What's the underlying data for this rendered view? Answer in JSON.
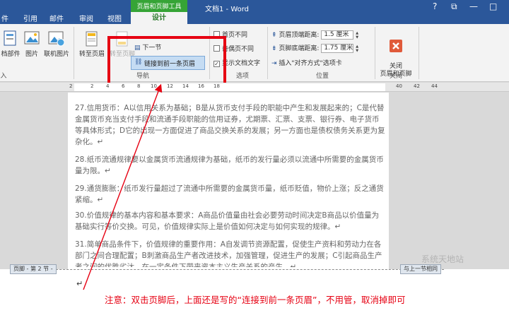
{
  "titlebar": {
    "tabs": [
      "件",
      "引用",
      "邮件",
      "审阅",
      "视图"
    ],
    "contextual_title": "页眉和页脚工具",
    "contextual_tab": "设计",
    "doc_title": "文档1 - Word",
    "controls": [
      "?",
      "⧉",
      "—",
      "□"
    ]
  },
  "ribbon": {
    "insert_group": {
      "buttons": [
        "档部件",
        "图片",
        "联机图片"
      ],
      "label": "入"
    },
    "navigation": {
      "goto_header": "转至页眉",
      "goto_footer": "转至页脚",
      "next_section": "下一节",
      "link_previous": "链接到前一条页眉",
      "label": "导航"
    },
    "options": {
      "items": [
        {
          "label": "首页不同",
          "checked": false
        },
        {
          "label": "奇偶页不同",
          "checked": false
        },
        {
          "label": "显示文档文字",
          "checked": true
        }
      ],
      "label": "选项"
    },
    "position": {
      "header_label": "页眉顶端距离:",
      "header_value": "1.5 厘米",
      "footer_label": "页脚底端距离:",
      "footer_value": "1.75 厘米",
      "align_tab": "插入\"对齐方式\"选项卡",
      "label": "位置"
    },
    "close": {
      "button": "关闭\n页眉和页脚",
      "label": "关闭"
    }
  },
  "ruler": {
    "numbers": [
      "2",
      "2",
      "4",
      "6",
      "8",
      "10",
      "12",
      "14",
      "16",
      "18"
    ],
    "side_numbers": [
      "40",
      "42",
      "44"
    ]
  },
  "document": {
    "paragraphs": [
      "27.信用货币：A以信用关系为基础；B是从货币支付手段的职能中产生和发展起来的；C是代替金属货币充当支付手段和流通手段职能的信用证券，尤期票、汇票、支票、银行券、电子货币等具体形式；D它的出现一方面促进了商品交换关系的发展；另一方面也是债权债务关系更为复杂化。↵",
      "28.纸币流通规律要以金属货币流通规律为基础，纸币的发行量必须以流通中所需要的金属货币量为限。↵",
      "29.通货膨胀：纸币发行量超过了流通中所需要的金属货币量，纸币贬值，物价上涨；反之通货紧缩。↵",
      "30.价值规律的基本内容和基本要求：A商品价值量由社会必要劳动时间决定B商品以价值量为基础实行等价交换。可见，价值规律实际上是价值如何决定与如何实现的规律。↵",
      "31.简单商品条件下，价值规律的重要作用：A自发调节资源配置，促使生产资料和劳动力在各部门之间合理配置；B刺激商品生产者改进技术，加强管理，促进生产的发展；C引起商品生产者之间的优胜劣汰，在一定条件下带来资本主义生产关系的产生。↵"
    ],
    "footer_tag": "页脚 - 第 2 节 -",
    "same_as_previous": "与上一节相同",
    "footer_mark": "↵"
  },
  "annotation": {
    "note": "注意：双击页脚后，上面还是写的“连接到前一条页眉”，不用管，取消掉即可",
    "watermark": "系统天地站"
  },
  "colors": {
    "title_blue": "#2b579a",
    "contextual_green": "#36a436",
    "highlight_red": "#e60012"
  }
}
